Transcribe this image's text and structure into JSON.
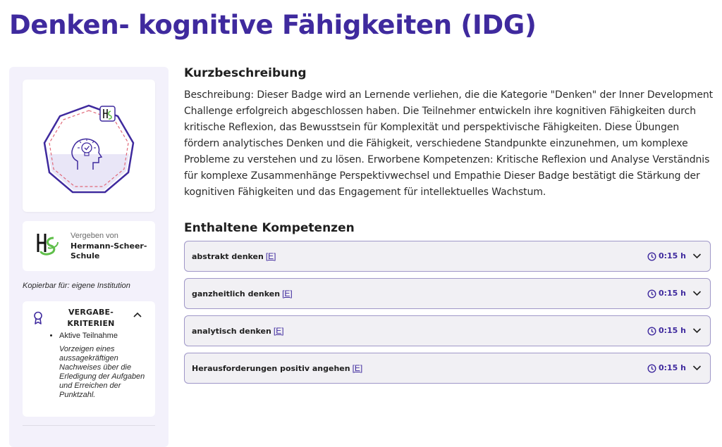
{
  "page": {
    "title": "Denken- kognitive Fähigkeiten (IDG)"
  },
  "sidebar": {
    "issuer_label": "Vergeben von",
    "issuer_name": "Hermann-Scheer-Schule",
    "copyable_note": "Kopierbar für: eigene Institution",
    "criteria": {
      "title": "VERGABE-KRITERIEN",
      "items": [
        "Aktive Teilnahme"
      ],
      "description": "Vorzeigen eines aussagekräftigen Nachweises über die Erledigung der Aufgaben und Erreichen der Punktzahl."
    }
  },
  "summary": {
    "heading": "Kurzbeschreibung",
    "text": "Beschreibung: Dieser Badge wird an Lernende verliehen, die die Kategorie \"Denken\" der Inner Development Challenge erfolgreich abgeschlossen haben. Die Teilnehmer entwickeln ihre kognitiven Fähigkeiten durch kritische Reflexion, das Bewusstsein für Komplexität und perspektivische Fähigkeiten. Diese Übungen fördern analytisches Denken und die Fähigkeit, verschiedene Standpunkte einzunehmen, um komplexe Probleme zu verstehen und zu lösen. Erworbene Kompetenzen: Kritische Reflexion und Analyse Verständnis für komplexe Zusammenhänge Perspektivwechsel und Empathie Dieser Badge bestätigt die Stärkung der kognitiven Fähigkeiten und das Engagement für intellektuelles Wachstum."
  },
  "competencies": {
    "heading": "Enthaltene Kompetenzen",
    "items": [
      {
        "name": "abstrakt denken",
        "link": "[E]",
        "time": "0:15 h"
      },
      {
        "name": "ganzheitlich denken",
        "link": "[E]",
        "time": "0:15 h"
      },
      {
        "name": "analytisch denken",
        "link": "[E]",
        "time": "0:15 h"
      },
      {
        "name": "Herausforderungen positiv angehen",
        "link": "[E]",
        "time": "0:15 h"
      }
    ]
  },
  "icons": {
    "badge": "lightbulb-head-badge-icon",
    "issuer_logo": "hss-logo-icon",
    "criteria": "award-ribbon-icon",
    "criteria_toggle": "chevron-up-icon",
    "time": "clock-icon",
    "expand": "chevron-down-icon"
  },
  "colors": {
    "brand": "#3f2a9e",
    "sidebar_bg": "#f3f1fb",
    "accordion_bg": "#f1f0f4",
    "accordion_border": "#9f97c8",
    "badge_dash": "#e06a7a",
    "logo_green": "#5fbf4a"
  }
}
